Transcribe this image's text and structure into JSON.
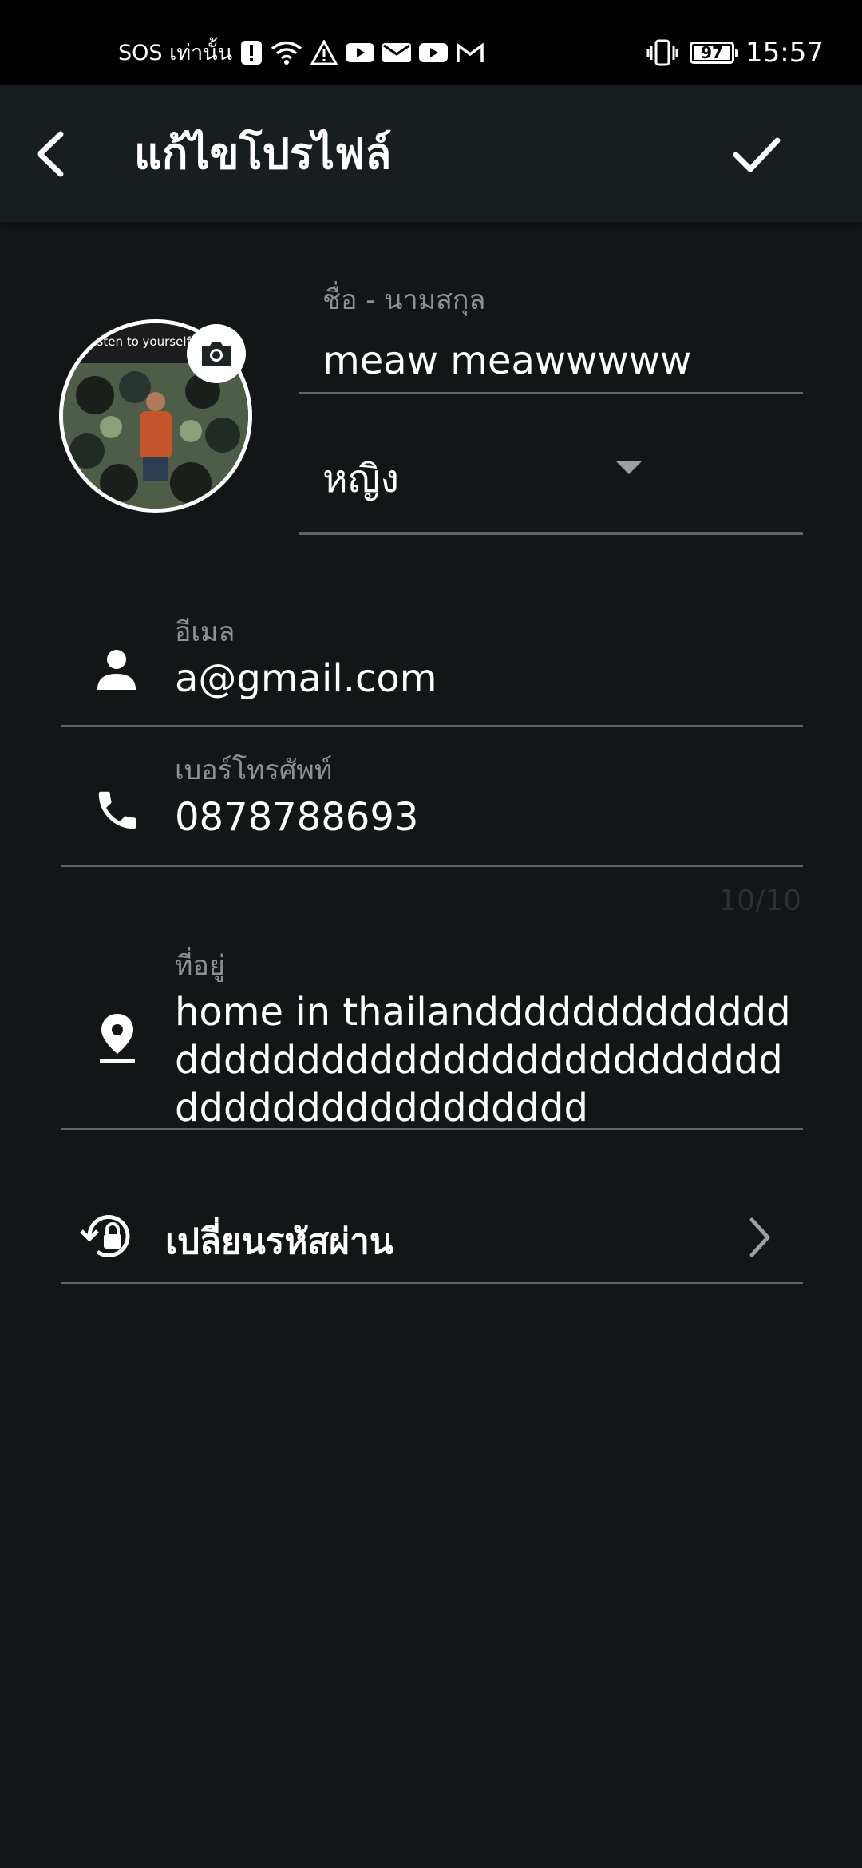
{
  "status_bar": {
    "carrier": "SOS เท่านั้น",
    "battery": "97",
    "time": "15:57"
  },
  "header": {
    "title": "แก้ไขโปรไฟล์"
  },
  "profile": {
    "name_label": "ชื่อ - นามสกุล",
    "name_value": "meaw meawwwww",
    "gender_value": "หญิง",
    "avatar_caption": "Listen to yourself f"
  },
  "email": {
    "label": "อีเมล",
    "value": "a@gmail.com"
  },
  "phone": {
    "label": "เบอร์โทรศัพท์",
    "value": "0878788693",
    "counter": "10/10"
  },
  "address": {
    "label": "ที่อยู่",
    "value": "home in thailanddddddddddddddddddddddddddddddddddddddddddddddddddddddd"
  },
  "change_password": {
    "label": "เปลี่ยนรหัสผ่าน"
  },
  "colors": {
    "background": "#121617",
    "app_bar": "#181d1f",
    "divider": "#5f6467",
    "label": "#8d9193"
  }
}
